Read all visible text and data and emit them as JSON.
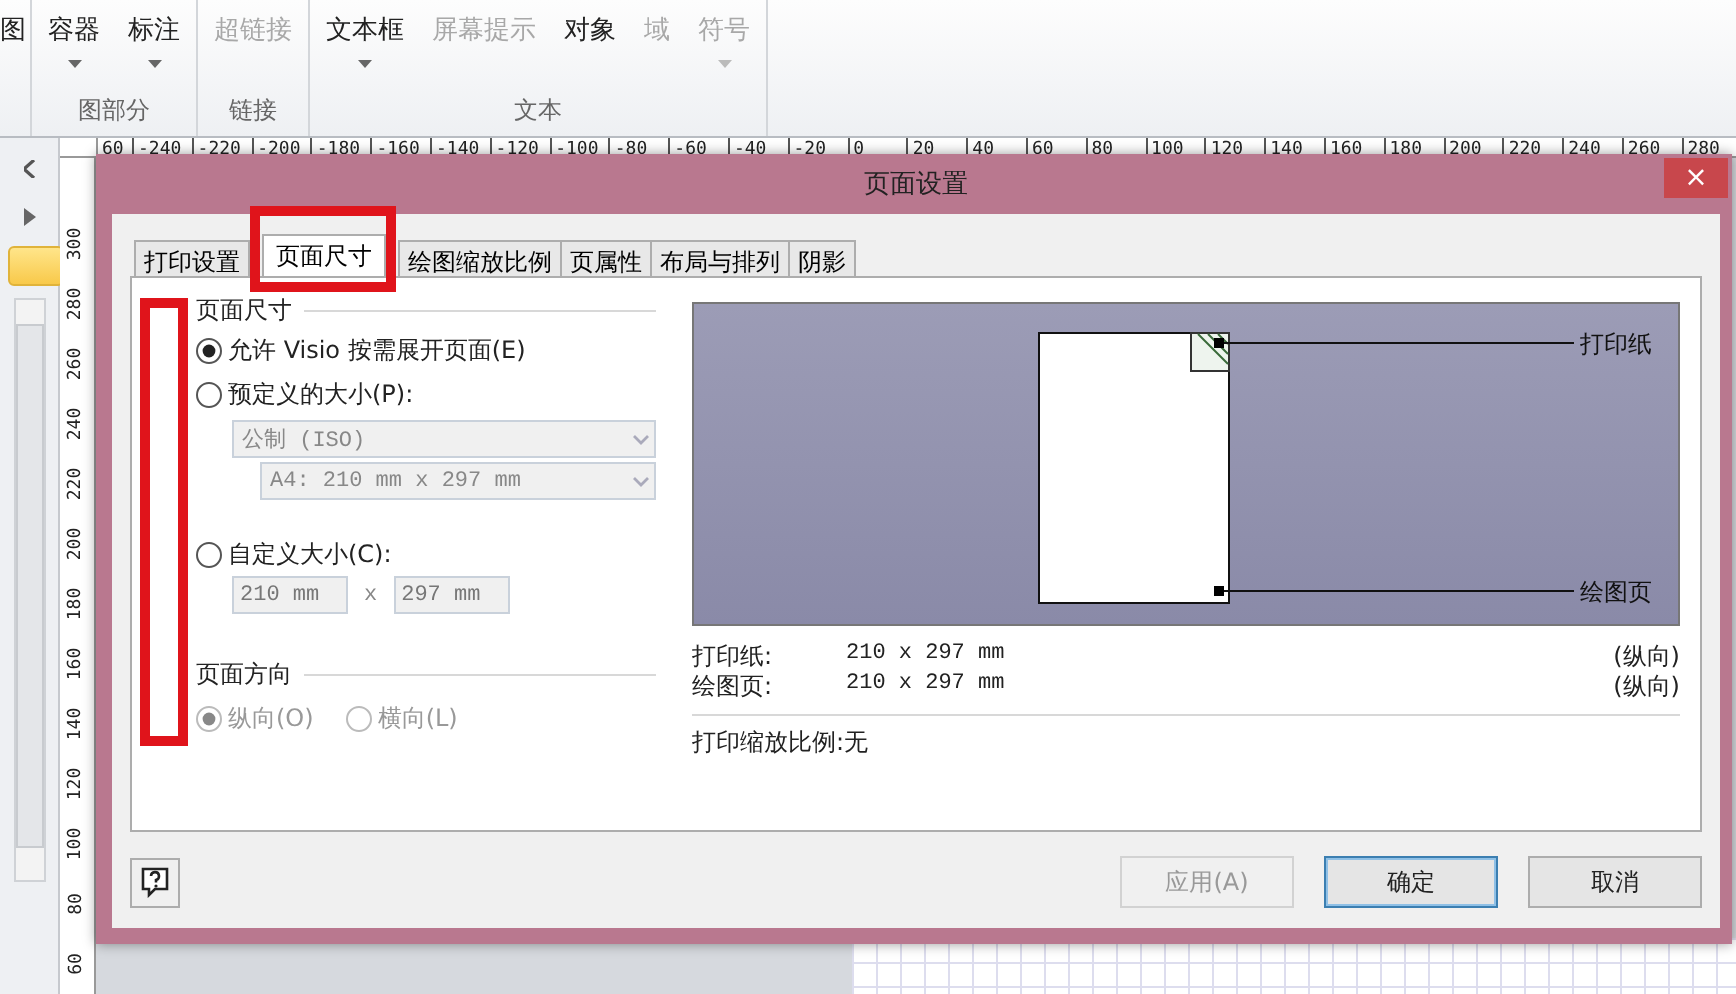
{
  "ribbon": {
    "cut_item": "图",
    "groups": [
      {
        "label": "图部分",
        "items": [
          {
            "label": "容器",
            "disabled": false,
            "dropdown": true
          },
          {
            "label": "标注",
            "disabled": false,
            "dropdown": true
          }
        ]
      },
      {
        "label": "链接",
        "items": [
          {
            "label": "超链接",
            "disabled": true,
            "dropdown": false
          }
        ]
      },
      {
        "label": "文本",
        "items": [
          {
            "label": "文本框",
            "disabled": false,
            "dropdown": true
          },
          {
            "label": "屏幕提示",
            "disabled": true,
            "dropdown": false
          },
          {
            "label": "对象",
            "disabled": false,
            "dropdown": false
          },
          {
            "label": "域",
            "disabled": true,
            "dropdown": false
          },
          {
            "label": "符号",
            "disabled": true,
            "dropdown": true
          }
        ]
      }
    ]
  },
  "horizontal_ruler": [
    "60",
    "-240",
    "-220",
    "-200",
    "-180",
    "-160",
    "-140",
    "-120",
    "-100",
    "-80",
    "-60",
    "-40",
    "-20",
    "0",
    "20",
    "40",
    "60",
    "80",
    "100",
    "120",
    "140",
    "160",
    "180",
    "200",
    "220",
    "240",
    "260",
    "280"
  ],
  "vertical_ruler": [
    "300",
    "280",
    "260",
    "240",
    "220",
    "200",
    "180",
    "160",
    "140",
    "120",
    "100",
    "80",
    "60"
  ],
  "dialog": {
    "title": "页面设置",
    "close": "×",
    "tabs": [
      {
        "label": "打印设置",
        "selected": false
      },
      {
        "label": "页面尺寸",
        "selected": true
      },
      {
        "label": "绘图缩放比例",
        "selected": false
      },
      {
        "label": "页属性",
        "selected": false
      },
      {
        "label": "布局与排列",
        "selected": false
      },
      {
        "label": "阴影",
        "selected": false
      }
    ],
    "page_size": {
      "label": "页面尺寸",
      "options": [
        {
          "label": "允许 Visio 按需展开页面(E)",
          "selected": true
        },
        {
          "label": "预定义的大小(P):",
          "selected": false
        },
        {
          "label": "自定义大小(C):",
          "selected": false
        }
      ],
      "dropdowns": [
        {
          "value": "公制 (ISO)",
          "disabled": true
        },
        {
          "value": "A4:  210 mm x 297 mm",
          "disabled": true
        }
      ],
      "width": {
        "value": "210 mm",
        "disabled": true
      },
      "times": "x",
      "height": {
        "value": "297 mm",
        "disabled": true
      }
    },
    "orientation": {
      "label": "页面方向",
      "options": [
        {
          "label": "纵向(O)",
          "selected": true,
          "disabled": true
        },
        {
          "label": "横向(L)",
          "selected": false,
          "disabled": true
        }
      ]
    },
    "preview": {
      "paper_label": "打印纸",
      "drawing_label": "绘图页"
    },
    "info": [
      {
        "label": "打印纸:",
        "value": "210 x 297 mm",
        "orientation": "(纵向)"
      },
      {
        "label": "绘图页:",
        "value": "210 x 297 mm",
        "orientation": "(纵向)"
      }
    ],
    "scale": "打印缩放比例:无",
    "buttons": [
      {
        "label": "应用(A)",
        "disabled": true,
        "focused": false
      },
      {
        "label": "确定",
        "disabled": false,
        "focused": true
      },
      {
        "label": "取消",
        "disabled": false,
        "focused": false
      }
    ]
  }
}
